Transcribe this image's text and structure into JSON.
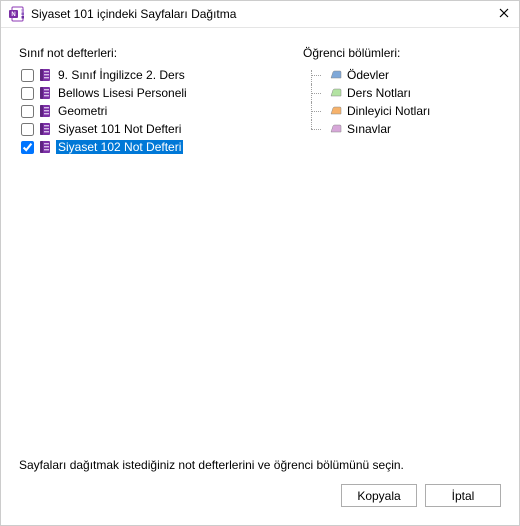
{
  "window": {
    "title": "Siyaset 101 içindeki Sayfaları Dağıtma"
  },
  "left": {
    "header": "Sınıf not defterleri:",
    "items": [
      {
        "label": "9. Sınıf İngilizce 2. Ders",
        "checked": false,
        "selected": false
      },
      {
        "label": "Bellows Lisesi Personeli",
        "checked": false,
        "selected": false
      },
      {
        "label": "Geometri",
        "checked": false,
        "selected": false
      },
      {
        "label": "Siyaset 101 Not Defteri",
        "checked": false,
        "selected": false
      },
      {
        "label": "Siyaset 102 Not Defteri",
        "checked": true,
        "selected": true
      }
    ]
  },
  "right": {
    "header": "Öğrenci bölümleri:",
    "items": [
      {
        "label": "Ödevler",
        "color": "#7fa8d8"
      },
      {
        "label": "Ders Notları",
        "color": "#b3e3a2"
      },
      {
        "label": "Dinleyici Notları",
        "color": "#f6b26b"
      },
      {
        "label": "Sınavlar",
        "color": "#d7a7d9"
      }
    ]
  },
  "instruction": "Sayfaları dağıtmak istediğiniz not defterlerini ve öğrenci bölümünü seçin.",
  "buttons": {
    "copy": "Kopyala",
    "cancel": "İptal"
  }
}
